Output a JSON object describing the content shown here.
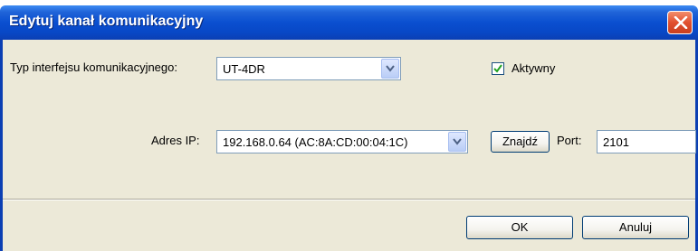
{
  "window": {
    "title": "Edytuj kanał komunikacyjny"
  },
  "form": {
    "interface_type_label": "Typ interfejsu komunikacyjnego:",
    "interface_type_value": "UT-4DR",
    "active_label": "Aktywny",
    "active_checked": true,
    "ip_label": "Adres IP:",
    "ip_value": "192.168.0.64 (AC:8A:CD:00:04:1C)",
    "find_button": "Znajdź",
    "port_label": "Port:",
    "port_value": "2101"
  },
  "buttons": {
    "ok": "OK",
    "cancel": "Anuluj"
  },
  "colors": {
    "titlebar": "#0a4fd0",
    "close_button": "#e1502f",
    "dialog_background": "#ece9d8",
    "interface_field_background": "#ffffff"
  },
  "icons": {
    "close": "close-icon",
    "dropdown": "chevron-down-icon",
    "check": "check-icon"
  }
}
